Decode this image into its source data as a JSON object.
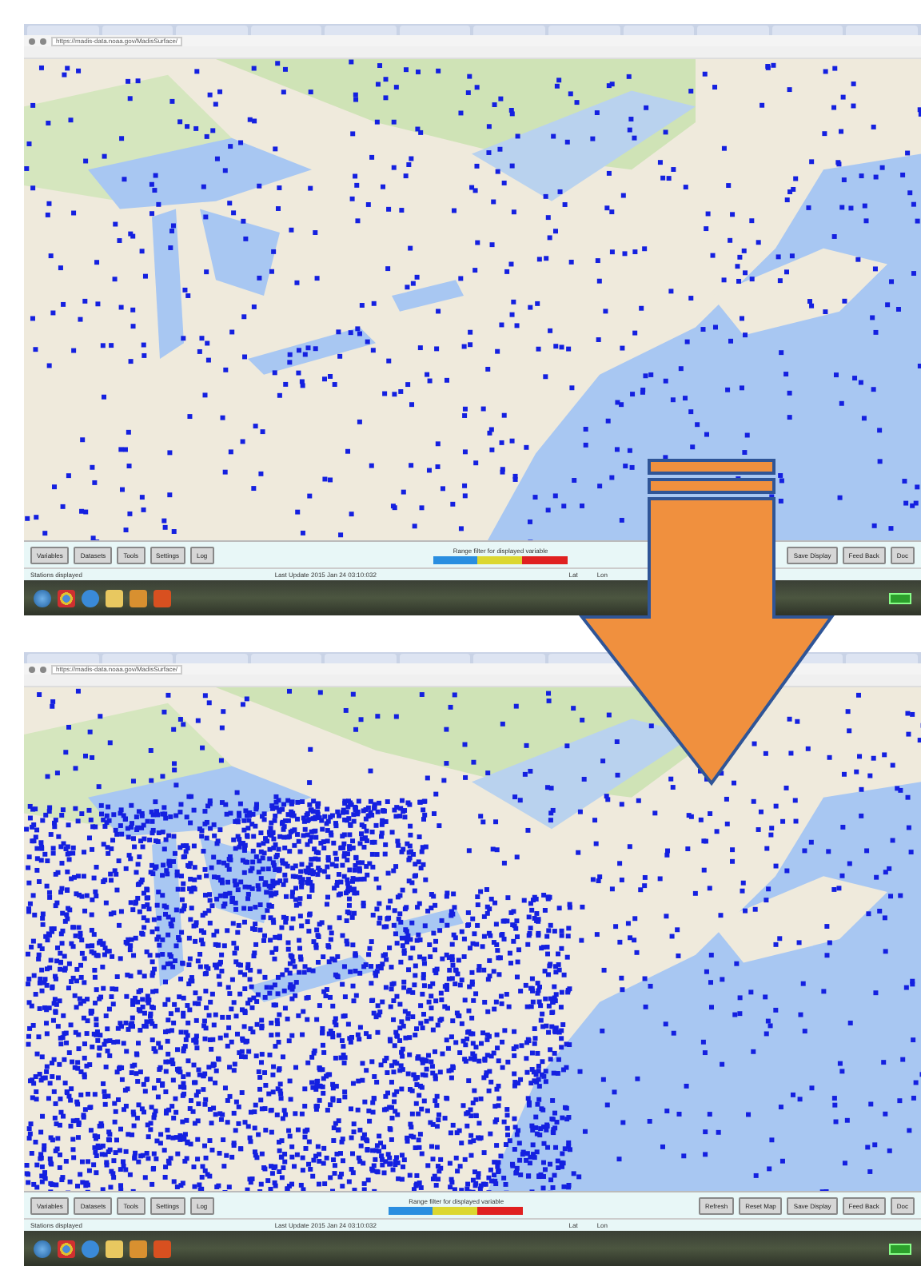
{
  "screenshots": [
    {
      "address": "https://madis-data.noaa.gov/MadisSurface/",
      "toolbar_left": [
        "Variables",
        "Datasets",
        "Tools",
        "Settings",
        "Log"
      ],
      "range_filter": "Range filter for displayed variable",
      "toolbar_right": [
        "Save Display",
        "Feed Back",
        "Doc"
      ],
      "status": {
        "stations": "Stations displayed",
        "last_update": "Last Update 2015 Jan 24 03:10:032",
        "lat": "Lat",
        "lon": "Lon"
      }
    },
    {
      "address": "https://madis-data.noaa.gov/MadisSurface/",
      "toolbar_left": [
        "Variables",
        "Datasets",
        "Tools",
        "Settings",
        "Log"
      ],
      "range_filter": "Range filter for displayed variable",
      "toolbar_right": [
        "Refresh",
        "Reset Map",
        "Save Display",
        "Feed Back",
        "Doc"
      ],
      "status": {
        "stations": "Stations displayed",
        "last_update": "Last Update 2015 Jan 24 03:10:032",
        "lat": "Lat",
        "lon": "Lon"
      }
    }
  ]
}
